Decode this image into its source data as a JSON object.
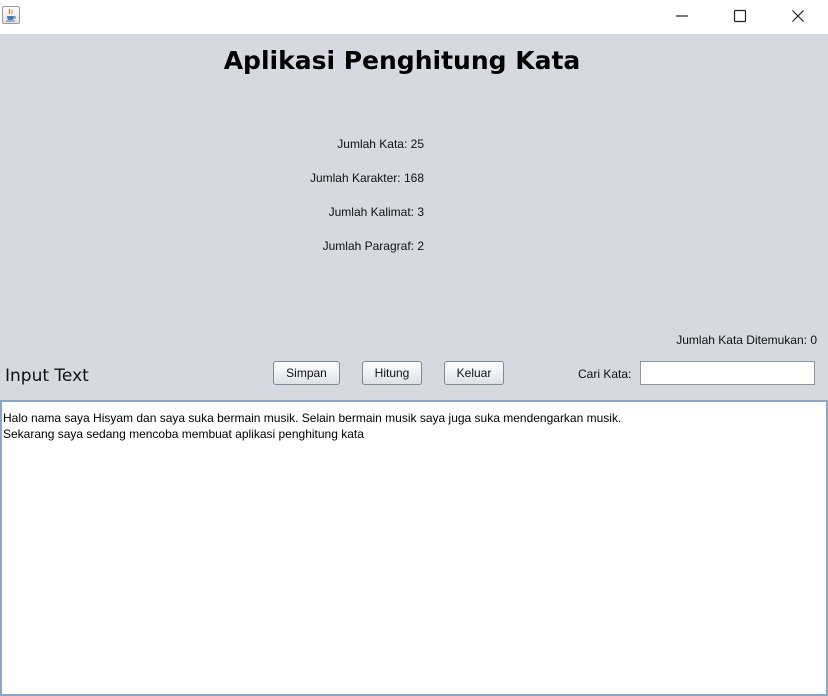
{
  "window": {
    "title": ""
  },
  "header": {
    "title": "Aplikasi Penghitung Kata"
  },
  "stats": {
    "words": "Jumlah Kata: 25",
    "characters": "Jumlah Karakter: 168",
    "sentences": "Jumlah Kalimat: 3",
    "paragraphs": "Jumlah Paragraf: 2",
    "found_words": "Jumlah Kata Ditemukan: 0"
  },
  "input": {
    "label": "Input Text",
    "text": "Halo nama saya Hisyam dan saya suka bermain musik. Selain bermain musik saya juga suka mendengarkan musik.\nSekarang saya sedang mencoba membuat aplikasi penghitung kata"
  },
  "toolbar": {
    "save_label": "Simpan",
    "count_label": "Hitung",
    "exit_label": "Keluar"
  },
  "search": {
    "label": "Cari Kata:",
    "value": ""
  },
  "icons": {
    "app": "java-app-icon",
    "minimize": "minimize-icon",
    "maximize": "maximize-icon",
    "close": "close-icon"
  },
  "colors": {
    "panel_background": "#d6d9e0",
    "titlebar_background": "#ffffff",
    "textarea_border": "#8aa6c4"
  }
}
